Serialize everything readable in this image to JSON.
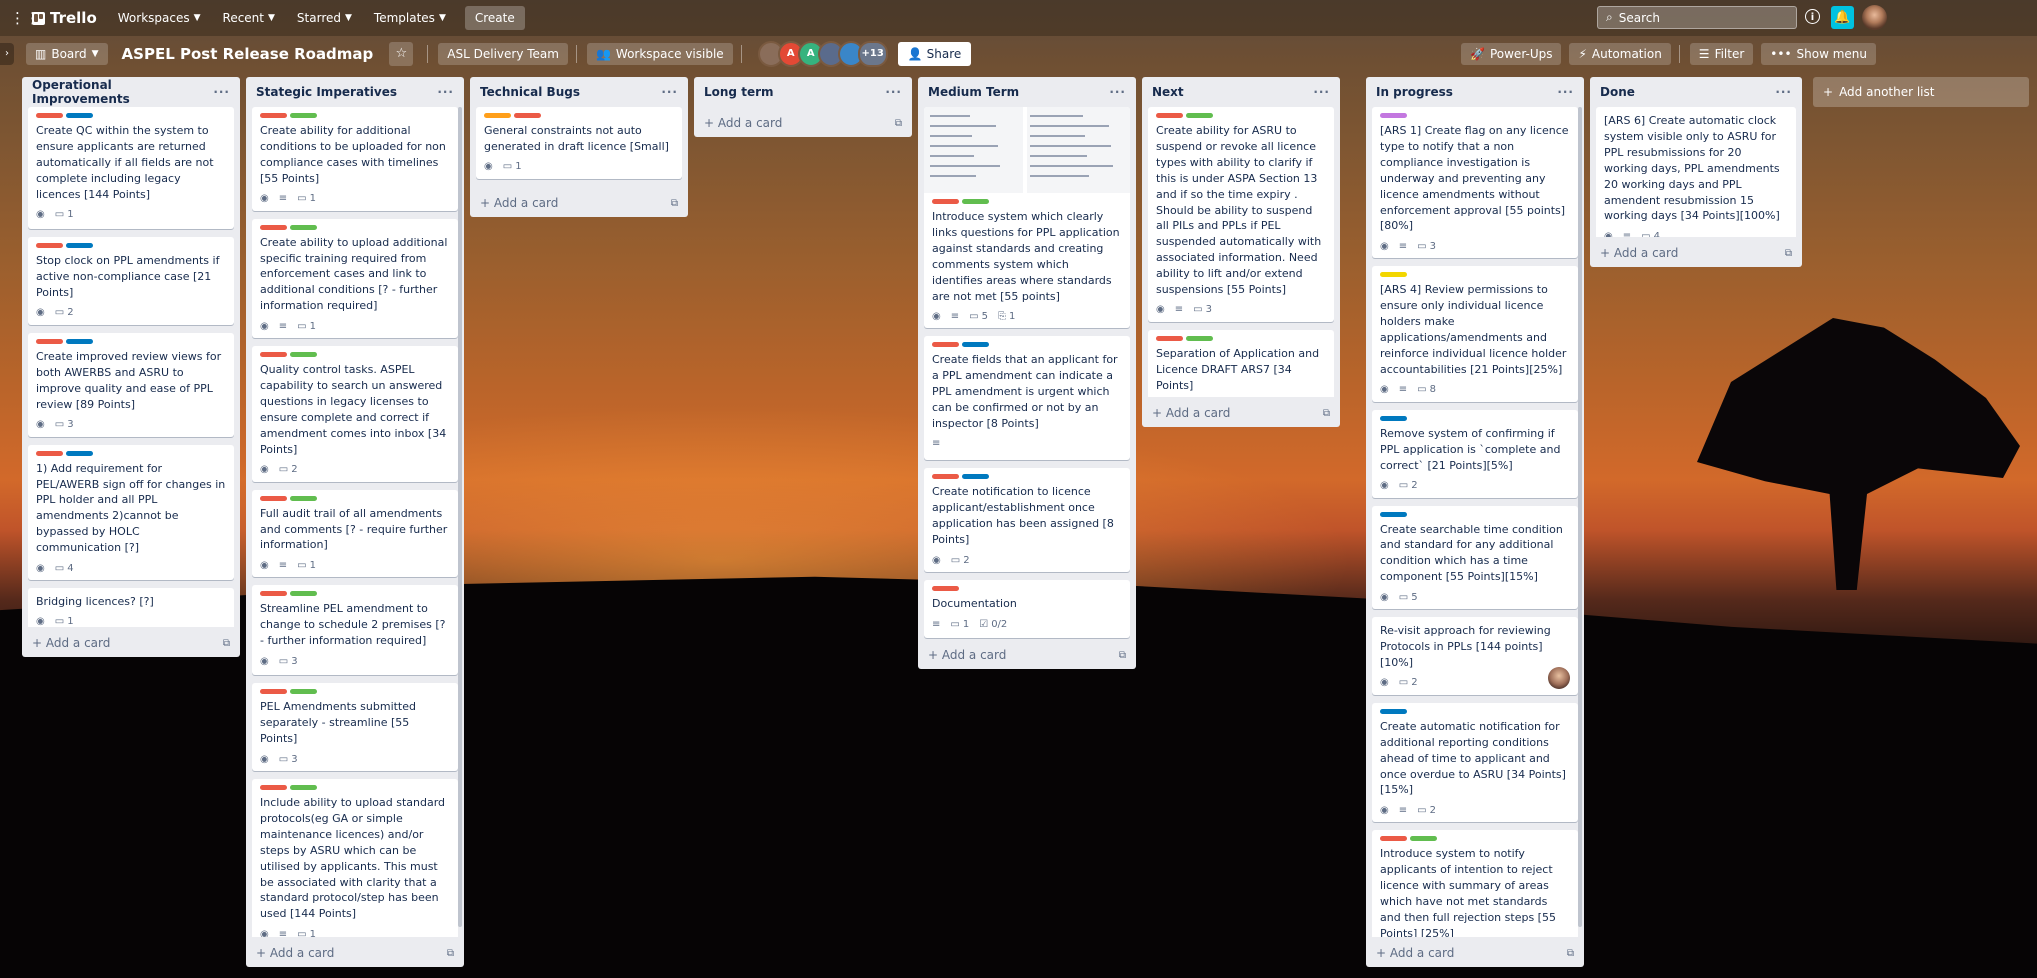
{
  "nav": {
    "logo": "Trello",
    "menus": [
      "Workspaces",
      "Recent",
      "Starred",
      "Templates"
    ],
    "create": "Create",
    "search_placeholder": "Search"
  },
  "board": {
    "view": "Board",
    "title": "ASPEL Post Release Roadmap",
    "team": "ASL Delivery Team",
    "visibility": "Workspace visible",
    "members": [
      {
        "initial": "",
        "color": "#8a6d5a"
      },
      {
        "initial": "A",
        "color": "#e34935"
      },
      {
        "initial": "A",
        "color": "#36b37e"
      },
      {
        "initial": "",
        "color": "#5a6b8c"
      },
      {
        "initial": "",
        "color": "#3a86c8"
      }
    ],
    "more_members": "+13",
    "share": "Share",
    "powerups": "Power-Ups",
    "automation": "Automation",
    "filter": "Filter",
    "show_menu": "Show menu",
    "add_list": "Add another list",
    "add_card": "Add a card"
  },
  "lists": [
    {
      "title": "Operational Improvements",
      "cards": [
        {
          "labels": [
            "red",
            "blue"
          ],
          "text": "Create QC within the system to ensure applicants are returned automatically if all fields are not complete including legacy licences [144 Points]",
          "badges": {
            "watch": true,
            "comments": "1"
          }
        },
        {
          "labels": [
            "red",
            "blue"
          ],
          "text": "Stop clock on PPL amendments if active non-compliance case [21 Points]",
          "badges": {
            "watch": true,
            "comments": "2"
          }
        },
        {
          "labels": [
            "red",
            "blue"
          ],
          "text": "Create improved review views for both AWERBS and ASRU to improve quality and ease of PPL review [89 Points]",
          "badges": {
            "watch": true,
            "comments": "3"
          }
        },
        {
          "labels": [
            "red",
            "blue"
          ],
          "text": "1) Add requirement for PEL/AWERB sign off for changes in PPL holder and all PPL amendments 2)cannot be bypassed by HOLC communication [?]",
          "badges": {
            "watch": true,
            "comments": "4"
          }
        },
        {
          "labels": [],
          "text": "Bridging licences? [?]",
          "badges": {
            "watch": true,
            "comments": "1"
          }
        }
      ]
    },
    {
      "title": "Stategic Imperatives",
      "cards": [
        {
          "labels": [
            "red",
            "green"
          ],
          "text": "Create ability for additional conditions to be uploaded for non compliance cases with timelines [55 Points]",
          "badges": {
            "watch": true,
            "desc": true,
            "comments": "1"
          }
        },
        {
          "labels": [
            "red",
            "green"
          ],
          "text": "Create ability to upload additional specific training required from enforcement cases and link to additional conditions [? - further information required]",
          "badges": {
            "watch": true,
            "desc": true,
            "comments": "1"
          }
        },
        {
          "labels": [
            "red",
            "green"
          ],
          "text": "Quality control tasks. ASPEL capability to search un answered questions in legacy licenses to ensure complete and correct if amendment comes into inbox [34 Points]",
          "badges": {
            "watch": true,
            "comments": "2"
          }
        },
        {
          "labels": [
            "red",
            "green"
          ],
          "text": "Full audit trail of all amendments and comments [? - require further information]",
          "badges": {
            "watch": true,
            "desc": true,
            "comments": "1"
          }
        },
        {
          "labels": [
            "red",
            "green"
          ],
          "text": "Streamline PEL amendment to change to schedule 2 premises [? - further information required]",
          "badges": {
            "watch": true,
            "comments": "3"
          }
        },
        {
          "labels": [
            "red",
            "green"
          ],
          "text": "PEL Amendments submitted separately - streamline [55 Points]",
          "badges": {
            "watch": true,
            "comments": "3"
          }
        },
        {
          "labels": [
            "red",
            "green"
          ],
          "text": "Include ability to upload standard protocols(eg GA or simple maintenance licences) and/or steps by ASRU which can be utilised by applicants. This must be associated with clarity that a standard protocol/step has been used [144 Points]",
          "badges": {
            "watch": true,
            "desc": true,
            "comments": "1"
          }
        }
      ]
    },
    {
      "title": "Technical Bugs",
      "cards": [
        {
          "labels": [
            "orange",
            "red"
          ],
          "text": "General constraints not auto generated in draft licence [Small]",
          "badges": {
            "watch": true,
            "comments": "1"
          }
        }
      ]
    },
    {
      "title": "Long term",
      "cards": []
    },
    {
      "title": "Medium Term",
      "cards": [
        {
          "cover": true,
          "labels": [
            "red",
            "green"
          ],
          "text": "Introduce system which clearly links questions for PPL application against standards and creating comments system which identifies areas where standards are not met [55 points]",
          "badges": {
            "watch": true,
            "desc": true,
            "comments": "5",
            "attach": "1"
          }
        },
        {
          "labels": [
            "red",
            "blue"
          ],
          "text": "Create fields that an applicant for a PPL amendment can indicate a PPL amendment is urgent which can be confirmed or not by an inspector [8 Points]",
          "badges": {
            "desc": true
          }
        },
        {
          "labels": [
            "red",
            "blue"
          ],
          "text": "Create notification to licence applicant/establishment once application has been assigned [8 Points]",
          "badges": {
            "watch": true,
            "comments": "2"
          }
        },
        {
          "labels": [
            "red"
          ],
          "text": "Documentation",
          "badges": {
            "desc": true,
            "comments": "1",
            "checklist": "0/2"
          }
        }
      ]
    },
    {
      "title": "Next",
      "cards": [
        {
          "labels": [
            "red",
            "green"
          ],
          "text": "Create ability for ASRU to suspend or revoke all licence types with ability to clarify if this is under ASPA Section 13 and if so the time expiry . Should be ability to suspend all PILs and PPLs if PEL suspended automatically with associated information. Need ability to lift and/or extend suspensions [55 Points]",
          "badges": {
            "watch": true,
            "desc": true,
            "comments": "3"
          }
        },
        {
          "labels": [
            "red",
            "green"
          ],
          "text": "Separation of Application and Licence DRAFT ARS7 [34 Points]",
          "badges": {
            "watch": true,
            "desc": true,
            "comments": "5"
          }
        }
      ]
    },
    {
      "title": "In progress",
      "cards": [
        {
          "labels": [
            "purple"
          ],
          "text": "[ARS 1] Create flag on any licence type to notify that a non compliance investigation is underway and preventing any licence amendments without enforcement approval [55 points] [80%]",
          "badges": {
            "watch": true,
            "desc": true,
            "comments": "3"
          }
        },
        {
          "labels": [
            "yellow"
          ],
          "text": "[ARS 4] Review permissions to ensure only individual licence holders make applications/amendments and reinforce individual licence holder accountabilities [21 Points][25%]",
          "badges": {
            "watch": true,
            "desc": true,
            "comments": "8"
          }
        },
        {
          "labels": [
            "blue"
          ],
          "text": "Remove system of confirming if PPL application is `complete and correct` [21 Points][5%]",
          "badges": {
            "watch": true,
            "comments": "2"
          }
        },
        {
          "labels": [
            "blue"
          ],
          "text": "Create searchable time condition and standard for any additional condition which has a time component [55 Points][15%]",
          "badges": {
            "watch": true,
            "comments": "5"
          }
        },
        {
          "labels": [],
          "text": "Re-visit approach for reviewing Protocols in PPLs [144 points][10%]",
          "badges": {
            "watch": true,
            "comments": "2"
          },
          "member": true
        },
        {
          "labels": [
            "blue"
          ],
          "text": "Create automatic notification for additional reporting conditions ahead of time to applicant and once overdue to ASRU [34 Points] [15%]",
          "badges": {
            "watch": true,
            "desc": true,
            "comments": "2"
          }
        },
        {
          "labels": [
            "red",
            "green"
          ],
          "text": "Introduce system to notify applicants of intention to reject licence with summary of areas which have not met standards and then full rejection steps [55 Points] [25%]",
          "badges": {}
        }
      ]
    },
    {
      "title": "Done",
      "cards": [
        {
          "labels": [],
          "text": "[ARS 6] Create automatic clock system visible only to ASRU for PPL resubmissions for 20 working days, PPL amendments 20 working days and PPL amendent resubmission 15 working days [34 Points][100%]",
          "badges": {
            "watch": true,
            "desc": true,
            "comments": "4"
          }
        }
      ]
    }
  ]
}
